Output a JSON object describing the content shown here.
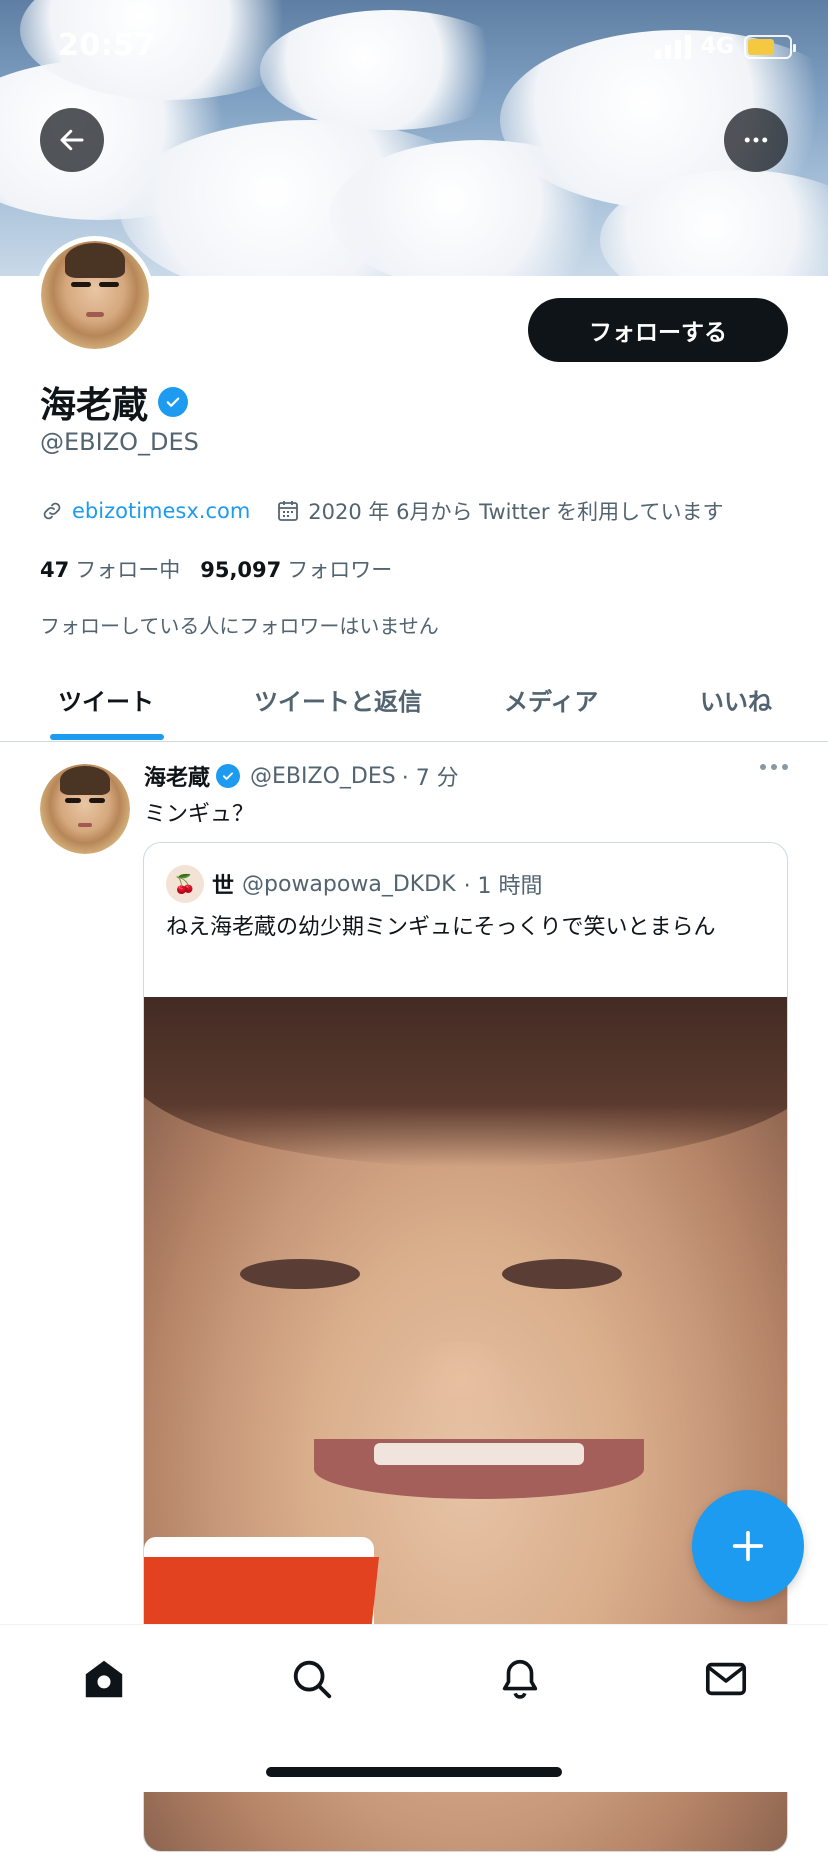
{
  "status_bar": {
    "time": "20:57",
    "network": "4G"
  },
  "profile": {
    "name": "海老蔵",
    "handle": "@EBIZO_DES",
    "follow_label": "フォローする",
    "website": "ebizotimesx.com",
    "joined": "2020 年 6月から Twitter を利用しています",
    "following_count": "47",
    "following_label": "フォロー中",
    "followers_count": "95,097",
    "followers_label": "フォロワー",
    "followers_note": "フォローしている人にフォロワーはいません"
  },
  "tabs": [
    {
      "label": "ツイート",
      "active": true
    },
    {
      "label": "ツイートと返信",
      "active": false
    },
    {
      "label": "メディア",
      "active": false
    },
    {
      "label": "いいね",
      "active": false
    }
  ],
  "tweet": {
    "name": "海老蔵",
    "handle": "@EBIZO_DES",
    "time": "· 7 分",
    "text": "ミンギュ？",
    "quote": {
      "name": "世",
      "handle": "@powapowa_DKDK",
      "time": "· 1 時間",
      "text": "ねえ海老蔵の幼少期ミンギュにそっくりで笑いとまらん"
    }
  },
  "icons": {
    "back": "arrow-left-icon",
    "more": "more-horizontal-icon",
    "link": "link-icon",
    "calendar": "calendar-icon",
    "compose": "plus-icon",
    "nav": [
      "home-icon",
      "search-icon",
      "bell-icon",
      "mail-icon"
    ]
  },
  "colors": {
    "accent": "#1d9bf0",
    "text": "#0f1419",
    "secondary": "#536471"
  }
}
